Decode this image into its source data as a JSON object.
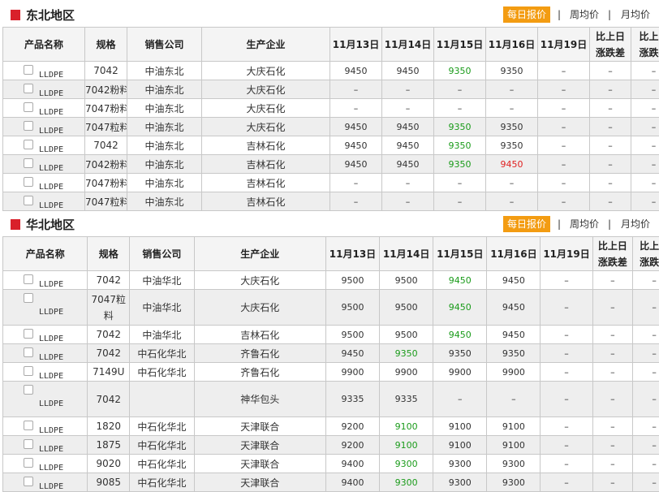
{
  "tabs": {
    "daily": "每日报价",
    "sep": "|",
    "weekly": "周均价",
    "monthly": "月均价"
  },
  "headers": {
    "product": "产品名称",
    "spec": "规格",
    "seller": "销售公司",
    "producer": "生产企业",
    "dates": [
      "11月13日",
      "11月14日",
      "11月15日",
      "11月16日",
      "11月19日"
    ],
    "diff1": "比上日",
    "diff2": "涨跌差",
    "rate1": "比上日",
    "rate2": "涨跌率"
  },
  "northeast": {
    "title": "东北地区",
    "rows": [
      {
        "product": "LLDPE",
        "spec": "7042",
        "seller": "中油东北",
        "producer": "大庆石化",
        "d1": "9450",
        "d2": "9450",
        "d3": "9350",
        "d4": "9350",
        "d5": "–",
        "diff": "–",
        "rate": "–",
        "c3": "green",
        "c4": ""
      },
      {
        "product": "LLDPE",
        "spec": "7042粉料",
        "seller": "中油东北",
        "producer": "大庆石化",
        "d1": "–",
        "d2": "–",
        "d3": "–",
        "d4": "–",
        "d5": "–",
        "diff": "–",
        "rate": "–",
        "c3": "",
        "c4": ""
      },
      {
        "product": "LLDPE",
        "spec": "7047粉料",
        "seller": "中油东北",
        "producer": "大庆石化",
        "d1": "–",
        "d2": "–",
        "d3": "–",
        "d4": "–",
        "d5": "–",
        "diff": "–",
        "rate": "–",
        "c3": "",
        "c4": ""
      },
      {
        "product": "LLDPE",
        "spec": "7047粒料",
        "seller": "中油东北",
        "producer": "大庆石化",
        "d1": "9450",
        "d2": "9450",
        "d3": "9350",
        "d4": "9350",
        "d5": "–",
        "diff": "–",
        "rate": "–",
        "c3": "green",
        "c4": ""
      },
      {
        "product": "LLDPE",
        "spec": "7042",
        "seller": "中油东北",
        "producer": "吉林石化",
        "d1": "9450",
        "d2": "9450",
        "d3": "9350",
        "d4": "9350",
        "d5": "–",
        "diff": "–",
        "rate": "–",
        "c3": "green",
        "c4": ""
      },
      {
        "product": "LLDPE",
        "spec": "7042粉料",
        "seller": "中油东北",
        "producer": "吉林石化",
        "d1": "9450",
        "d2": "9450",
        "d3": "9350",
        "d4": "9450",
        "d5": "–",
        "diff": "–",
        "rate": "–",
        "c3": "green",
        "c4": "red"
      },
      {
        "product": "LLDPE",
        "spec": "7047粉料",
        "seller": "中油东北",
        "producer": "吉林石化",
        "d1": "–",
        "d2": "–",
        "d3": "–",
        "d4": "–",
        "d5": "–",
        "diff": "–",
        "rate": "–",
        "c3": "",
        "c4": ""
      },
      {
        "product": "LLDPE",
        "spec": "7047粒料",
        "seller": "中油东北",
        "producer": "吉林石化",
        "d1": "–",
        "d2": "–",
        "d3": "–",
        "d4": "–",
        "d5": "–",
        "diff": "–",
        "rate": "–",
        "c3": "",
        "c4": ""
      }
    ]
  },
  "north": {
    "title": "华北地区",
    "rows": [
      {
        "product": "LLDPE",
        "spec": "7042",
        "seller": "中油华北",
        "producer": "大庆石化",
        "d1": "9500",
        "d2": "9500",
        "d3": "9450",
        "d4": "9450",
        "d5": "–",
        "diff": "–",
        "rate": "–",
        "c2": "",
        "c3": "green",
        "tall": false
      },
      {
        "product": "LLDPE",
        "spec": "7047粒料",
        "seller": "中油华北",
        "producer": "大庆石化",
        "d1": "9500",
        "d2": "9500",
        "d3": "9450",
        "d4": "9450",
        "d5": "–",
        "diff": "–",
        "rate": "–",
        "c2": "",
        "c3": "green",
        "tall": true
      },
      {
        "product": "LLDPE",
        "spec": "7042",
        "seller": "中油华北",
        "producer": "吉林石化",
        "d1": "9500",
        "d2": "9500",
        "d3": "9450",
        "d4": "9450",
        "d5": "–",
        "diff": "–",
        "rate": "–",
        "c2": "",
        "c3": "green",
        "tall": false
      },
      {
        "product": "LLDPE",
        "spec": "7042",
        "seller": "中石化华北",
        "producer": "齐鲁石化",
        "d1": "9450",
        "d2": "9350",
        "d3": "9350",
        "d4": "9350",
        "d5": "–",
        "diff": "–",
        "rate": "–",
        "c2": "green",
        "c3": "",
        "tall": false
      },
      {
        "product": "LLDPE",
        "spec": "7149U",
        "seller": "中石化华北",
        "producer": "齐鲁石化",
        "d1": "9900",
        "d2": "9900",
        "d3": "9900",
        "d4": "9900",
        "d5": "–",
        "diff": "–",
        "rate": "–",
        "c2": "",
        "c3": "",
        "tall": false
      },
      {
        "product": "LLDPE",
        "spec": "7042",
        "seller": "",
        "producer": "神华包头",
        "d1": "9335",
        "d2": "9335",
        "d3": "–",
        "d4": "–",
        "d5": "–",
        "diff": "–",
        "rate": "–",
        "c2": "",
        "c3": "",
        "tall": true
      },
      {
        "product": "LLDPE",
        "spec": "1820",
        "seller": "中石化华北",
        "producer": "天津联合",
        "d1": "9200",
        "d2": "9100",
        "d3": "9100",
        "d4": "9100",
        "d5": "–",
        "diff": "–",
        "rate": "–",
        "c2": "green",
        "c3": "",
        "tall": false
      },
      {
        "product": "LLDPE",
        "spec": "1875",
        "seller": "中石化华北",
        "producer": "天津联合",
        "d1": "9200",
        "d2": "9100",
        "d3": "9100",
        "d4": "9100",
        "d5": "–",
        "diff": "–",
        "rate": "–",
        "c2": "green",
        "c3": "",
        "tall": false
      },
      {
        "product": "LLDPE",
        "spec": "9020",
        "seller": "中石化华北",
        "producer": "天津联合",
        "d1": "9400",
        "d2": "9300",
        "d3": "9300",
        "d4": "9300",
        "d5": "–",
        "diff": "–",
        "rate": "–",
        "c2": "green",
        "c3": "",
        "tall": false
      },
      {
        "product": "LLDPE",
        "spec": "9085",
        "seller": "中石化华北",
        "producer": "天津联合",
        "d1": "9400",
        "d2": "9300",
        "d3": "9300",
        "d4": "9300",
        "d5": "–",
        "diff": "–",
        "rate": "–",
        "c2": "green",
        "c3": "",
        "tall": false
      }
    ]
  }
}
